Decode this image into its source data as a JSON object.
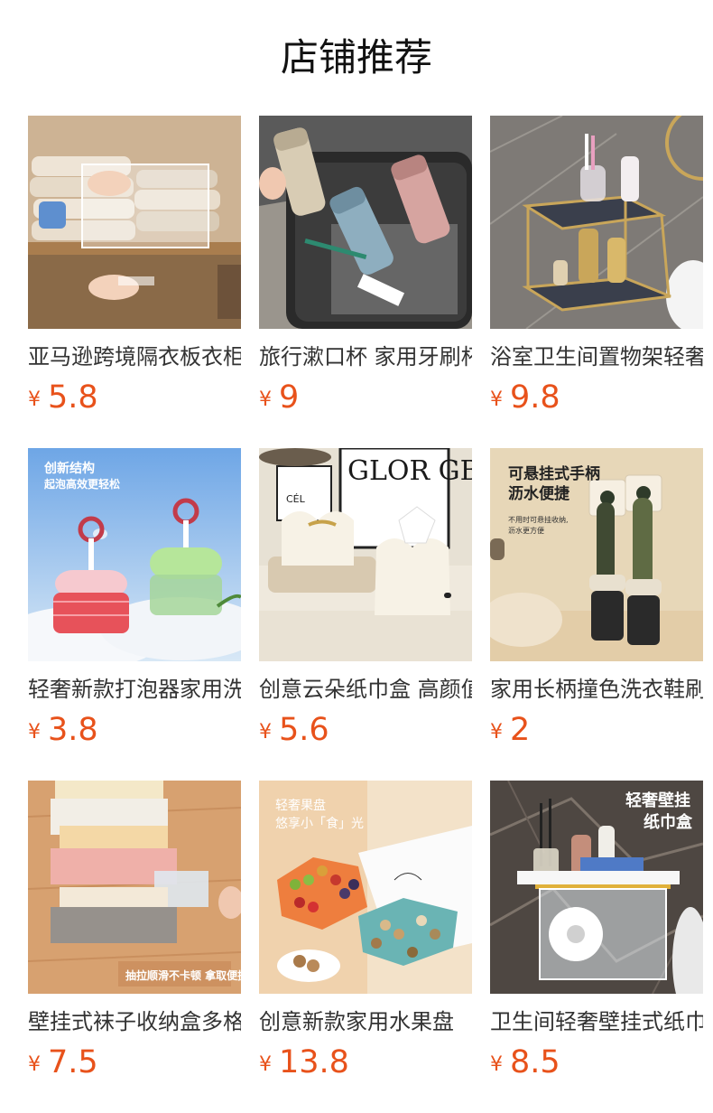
{
  "section": {
    "title": "店铺推荐"
  },
  "currency_symbol": "¥",
  "products": [
    {
      "name": "亚马逊跨境隔衣板衣柜分层隔板",
      "price": "5.8"
    },
    {
      "name": "旅行漱口杯 家用牙刷杯",
      "price": "9"
    },
    {
      "name": "浴室卫生间置物架轻奢",
      "price": "9.8"
    },
    {
      "name": "轻奢新款打泡器家用洗面奶",
      "price": "3.8"
    },
    {
      "name": "创意云朵纸巾盒 高颜值",
      "price": "5.6"
    },
    {
      "name": "家用长柄撞色洗衣鞋刷",
      "price": "2"
    },
    {
      "name": "壁挂式袜子收纳盒多格",
      "price": "7.5"
    },
    {
      "name": "创意新款家用水果盘",
      "price": "13.8"
    },
    {
      "name": "卫生间轻奢壁挂式纸巾盒",
      "price": "8.5"
    }
  ],
  "image_text": {
    "foamer_heading": "创新结构",
    "foamer_sub": "起泡高效更轻松",
    "tissue_poster": "GLOR GBAS FIT",
    "tissue_sign": "CÉL",
    "brush_heading_1": "可悬挂式手柄",
    "brush_heading_2": "沥水便捷",
    "brush_sub_1": "不用时可悬挂收纳,",
    "brush_sub_2": "沥水更方便",
    "socks_tag": "抽拉顺滑不卡顿 拿取便捷",
    "fruit_heading": "轻奢果盘",
    "fruit_sub": "悠享小「食」光",
    "holder_heading_1": "轻奢壁挂",
    "holder_heading_2": "纸巾盒"
  }
}
